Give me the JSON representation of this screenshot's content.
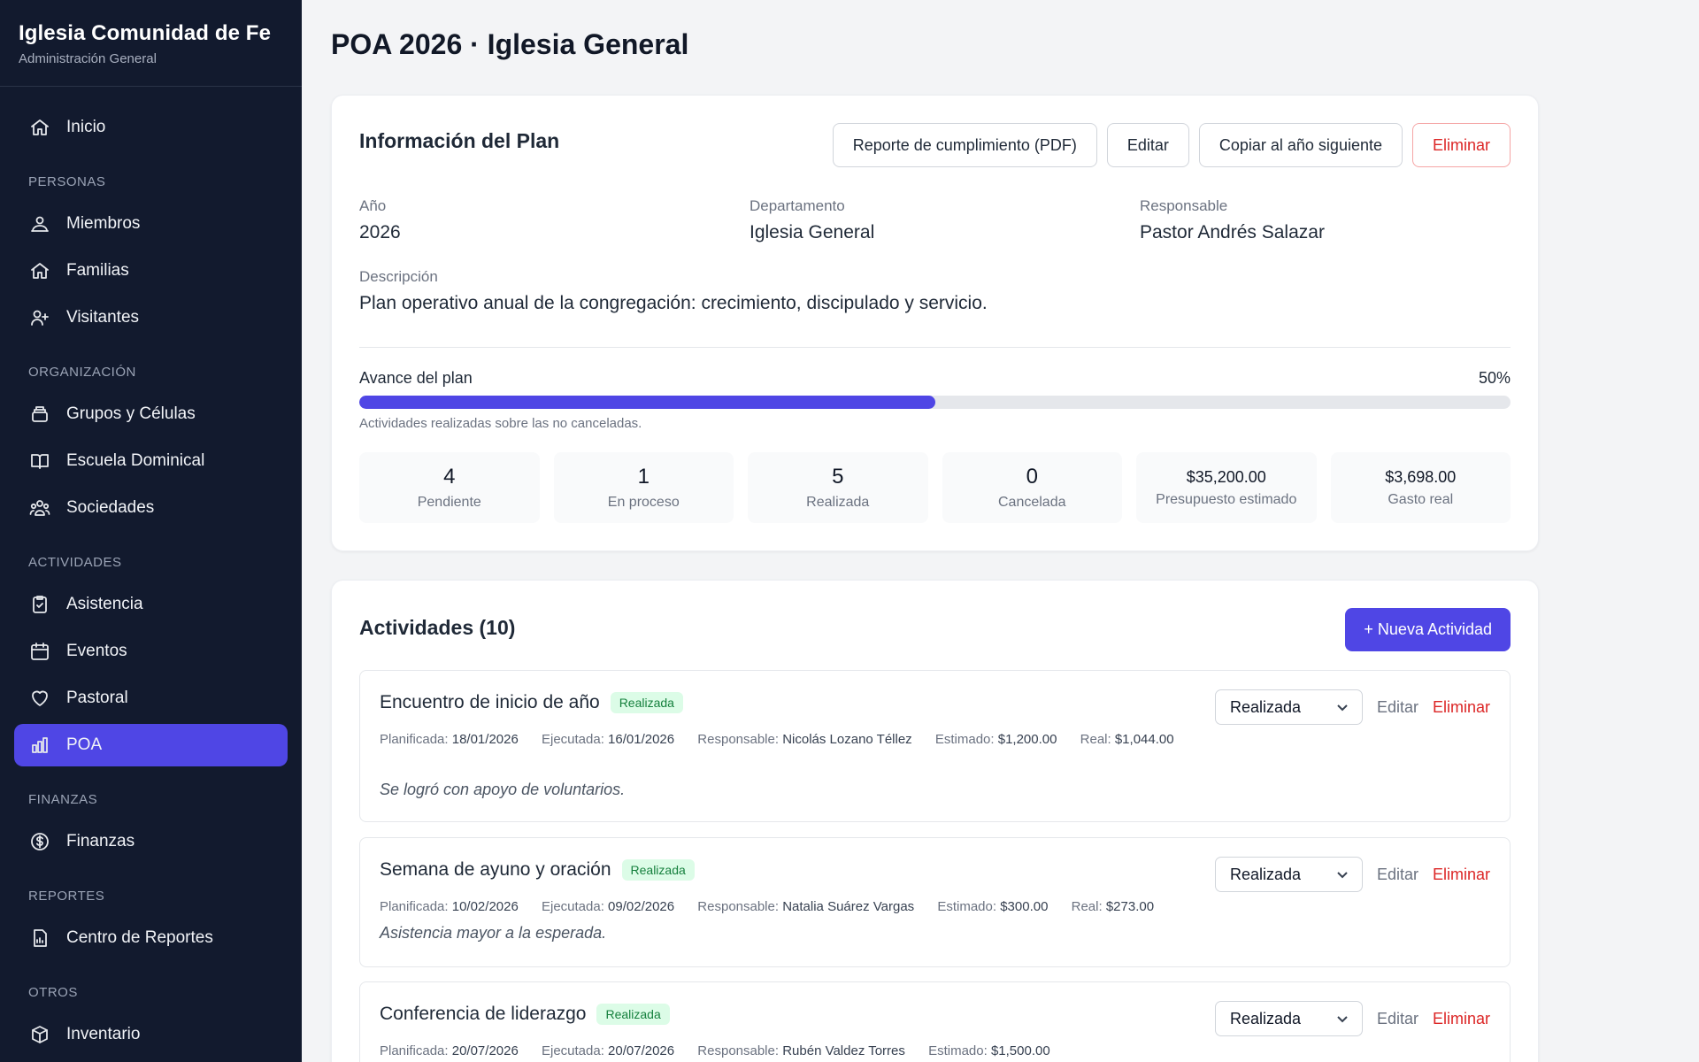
{
  "sidebar": {
    "brand_title": "Iglesia Comunidad de Fe",
    "brand_sub": "Administración General",
    "home": "Inicio",
    "sections": {
      "personas": "PERSONAS",
      "organizacion": "ORGANIZACIÓN",
      "actividades": "ACTIVIDADES",
      "finanzas": "FINANZAS",
      "reportes": "REPORTES",
      "otros": "OTROS"
    },
    "items": {
      "miembros": "Miembros",
      "familias": "Familias",
      "visitantes": "Visitantes",
      "grupos": "Grupos y Células",
      "escuela": "Escuela Dominical",
      "sociedades": "Sociedades",
      "asistencia": "Asistencia",
      "eventos": "Eventos",
      "pastoral": "Pastoral",
      "poa": "POA",
      "finanzas": "Finanzas",
      "reportes": "Centro de Reportes",
      "inventario": "Inventario"
    },
    "active_item": "poa"
  },
  "page": {
    "title": "POA 2026 · Iglesia General"
  },
  "info": {
    "title": "Información del Plan",
    "buttons": {
      "report": "Reporte de cumplimiento (PDF)",
      "edit": "Editar",
      "copy": "Copiar al año siguiente",
      "delete": "Eliminar"
    },
    "year_label": "Año",
    "year_value": "2026",
    "dept_label": "Departamento",
    "dept_value": "Iglesia General",
    "resp_label": "Responsable",
    "resp_value": "Pastor Andrés Salazar",
    "desc_label": "Descripción",
    "desc_value": "Plan operativo anual de la congregación: crecimiento, discipulado y servicio.",
    "progress_label": "Avance del plan",
    "progress_text": "50%",
    "progress_fraction": 0.5,
    "progress_note": "Actividades realizadas sobre las no canceladas.",
    "stats": [
      {
        "value": "4",
        "label": "Pendiente"
      },
      {
        "value": "1",
        "label": "En proceso"
      },
      {
        "value": "5",
        "label": "Realizada"
      },
      {
        "value": "0",
        "label": "Cancelada"
      },
      {
        "value": "$35,200.00",
        "label": "Presupuesto estimado"
      },
      {
        "value": "$3,698.00",
        "label": "Gasto real"
      }
    ]
  },
  "activities": {
    "title": "Actividades (10)",
    "new_button": "+ Nueva Actividad",
    "labels": {
      "planned": "Planificada:",
      "executed": "Ejecutada:",
      "responsible": "Responsable:",
      "estimated": "Estimado:",
      "real": "Real:",
      "edit": "Editar",
      "delete": "Eliminar"
    },
    "items": [
      {
        "name": "Encuentro de inicio de año",
        "status": "Realizada",
        "planned": "18/01/2026",
        "executed": "16/01/2026",
        "responsible": "Nicolás Lozano Téllez",
        "estimated": "$1,200.00",
        "real": "$1,044.00",
        "note": "Se logró con apoyo de voluntarios.",
        "select_value": "Realizada"
      },
      {
        "name": "Semana de ayuno y oración",
        "status": "Realizada",
        "planned": "10/02/2026",
        "executed": "09/02/2026",
        "responsible": "Natalia Suárez Vargas",
        "estimated": "$300.00",
        "real": "$273.00",
        "note": "Asistencia mayor a la esperada.",
        "select_value": "Realizada"
      },
      {
        "name": "Conferencia de liderazgo",
        "status": "Realizada",
        "planned": "20/07/2026",
        "executed": "20/07/2026",
        "responsible": "Rubén Valdez Torres",
        "estimated": "$1,500.00",
        "select_value": "Realizada"
      }
    ]
  },
  "colors": {
    "sidebar_bg": "#121a2e",
    "accent": "#4f46e5",
    "danger": "#dc2626",
    "success_bg": "#dcfce7",
    "success_text": "#15803d"
  }
}
